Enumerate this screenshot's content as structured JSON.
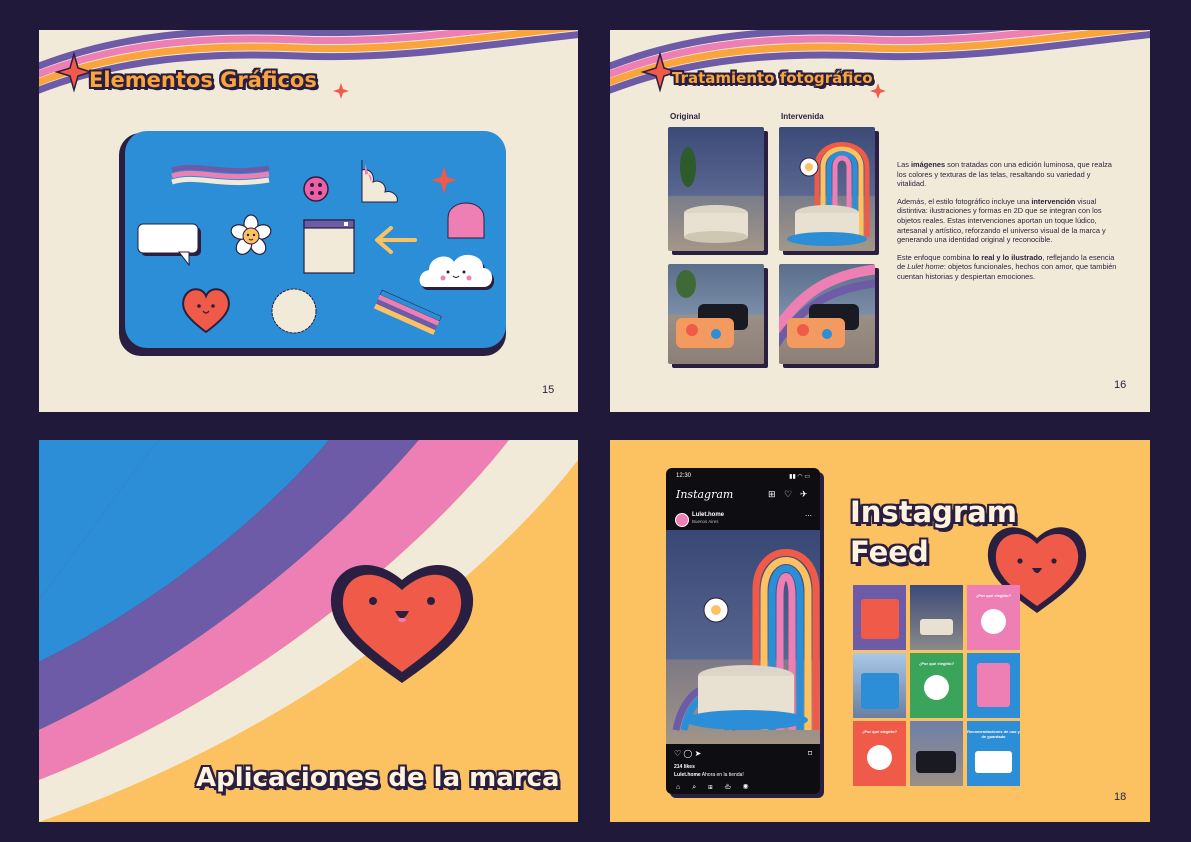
{
  "slide15": {
    "title": "Elementos Gráficos",
    "page_number": "15"
  },
  "slide16": {
    "title": "Tratamiento fotográfico",
    "col_original": "Original",
    "col_intervenida": "Intervenida",
    "p1_a": "Las ",
    "p1_b": "imágenes",
    "p1_c": " son tratadas con una edición luminosa, que realza los colores y texturas de las telas, resaltando su variedad y vitalidad.",
    "p2_a": "Además, el estilo fotográfico incluye una ",
    "p2_b": "intervención",
    "p2_c": " visual distintiva: ilustraciones y formas en 2D que se integran con los objetos reales. Estas intervenciones aportan un toque lúdico, artesanal y artístico, reforzando el universo visual de la marca y generando una identidad original y reconocible.",
    "p3_a": "Este enfoque combina ",
    "p3_b": "lo real y lo ilustrado",
    "p3_c": ", reflejando la esencia de ",
    "p3_d": "Lulet home",
    "p3_e": ": objetos funcionales, hechos con amor, que también cuentan historias y despiertan emociones.",
    "page_number": "16"
  },
  "slide17": {
    "title": "Aplicaciones de la marca"
  },
  "slide18": {
    "title_line1": "Instagram",
    "title_line2": "Feed",
    "page_number": "18",
    "phone": {
      "time": "12:30",
      "app_name": "Instagram",
      "account": "Lulet.home",
      "location": "Buenos Aires",
      "likes": "214 likes",
      "caption_user": "Lulet.home",
      "caption_text": "Ahora en la tienda!"
    },
    "grid_texts": {
      "c3": "¿Por qué elegirlo?",
      "c5": "¿Por qué elegirlo?",
      "c7": "¿Por qué elegirlo?",
      "c9": "Recomendaciones de uso y de guardado"
    }
  },
  "colors": {
    "background": "#21193a",
    "cream": "#f2ead8",
    "mustard": "#fcc262",
    "blue": "#2b8ed6",
    "purple": "#6e5ba8",
    "pink": "#ee7fb5",
    "orange": "#f9a43d",
    "red": "#ef5b48",
    "navy": "#2a1f40"
  }
}
